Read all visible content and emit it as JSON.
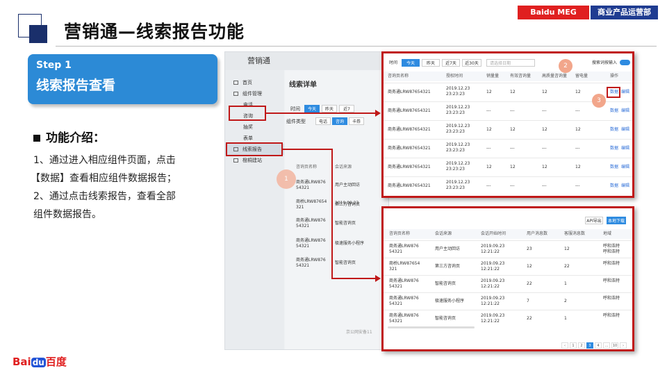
{
  "header": {
    "title": "营销通—线索报告功能",
    "badge_company": "Baidu MEG",
    "badge_dept": "商业产品运营部"
  },
  "step": {
    "label": "Step 1",
    "title": "线索报告查看"
  },
  "intro": {
    "heading": "功能介绍：",
    "line1": "1、通过进入相应组件页面，点击",
    "line2": "【数据】查看相应组件数据报告；",
    "line3": "2、通过点击线索报告，查看全部",
    "line4": "组件数据报告。"
  },
  "logo": {
    "bai": "Bai",
    "du": "du",
    "cn": "百度"
  },
  "app": {
    "title": "营销通",
    "sidebar": {
      "home": "首页",
      "component_mgmt": "组件管理",
      "sub_phone": "电话",
      "sub_consult": "咨询",
      "sub_coupon": "抽奖",
      "sub_form": "表单",
      "lead_report": "线索报告",
      "site_build": "橙桐建站"
    },
    "main": {
      "heading": "线索详单",
      "time_label": "时间",
      "time_today": "今天",
      "time_yesterday": "昨天",
      "time_7": "近7",
      "type_label": "组件类型",
      "type_phone": "电话",
      "type_consult": "咨询",
      "type_more": "卡券",
      "col_page": "咨询页名称",
      "col_source": "会话来源",
      "rows": [
        {
          "name": "商务通LRW876 54321",
          "source": "用户主动回访"
        },
        {
          "name": "商桥LRW87654 321",
          "source": "第三方咨询页"
        },
        {
          "name": "商务通LRW876 54321",
          "source": "智能咨询页"
        },
        {
          "name": "商务通LRW876 54321",
          "source": "极速服务小程序"
        },
        {
          "name": "商务通LRW876 54321",
          "source": "智能咨询页"
        }
      ],
      "peek_date": "2019.09.23",
      "peek_tag": "呼和浩特",
      "footer": "京公网安备11"
    }
  },
  "panel1": {
    "time_label": "时间",
    "tabs": [
      "今天",
      "昨天",
      "近7天",
      "近30天"
    ],
    "date_placeholder": "请选择日期",
    "search_toggle_label": "搜索词按输入",
    "columns": [
      "咨询页名称",
      "授权时间",
      "销量量",
      "有效咨询量",
      "高质量咨询量",
      "留电量",
      "操作"
    ],
    "rows": [
      {
        "name": "商务通LRW87654321",
        "time": "2019.12.23 23:23:23",
        "v1": "12",
        "v2": "12",
        "v3": "12",
        "v4": "12"
      },
      {
        "name": "商务通LRW87654321",
        "time": "2019.12.23 23:23:23",
        "v1": "---",
        "v2": "---",
        "v3": "---",
        "v4": "---"
      },
      {
        "name": "商务通LRW87654321",
        "time": "2019.12.23 23:23:23",
        "v1": "12",
        "v2": "12",
        "v3": "12",
        "v4": "12"
      },
      {
        "name": "商务通LRW87654321",
        "time": "2019.12.23 23:23:23",
        "v1": "---",
        "v2": "---",
        "v3": "---",
        "v4": "---"
      },
      {
        "name": "商务通LRW87654321",
        "time": "2019.12.23 23:23:23",
        "v1": "12",
        "v2": "12",
        "v3": "12",
        "v4": "12"
      },
      {
        "name": "商务通LRW87654321",
        "time": "2019.12.23 23:23:23",
        "v1": "---",
        "v2": "---",
        "v3": "---",
        "v4": "---"
      }
    ],
    "action_data": "数据",
    "action_edit": "编辑"
  },
  "panel2": {
    "api_button": "API导出",
    "export_button": "本地下载",
    "columns": [
      "咨询页名称",
      "会话来源",
      "会话开始时间",
      "用户消息数",
      "客服消息数",
      "地域"
    ],
    "rows": [
      {
        "name": "商务通LRW876 54321",
        "source": "用户主动回访",
        "time": "2019.09.23 12:21:22",
        "u": "23",
        "c": "12",
        "region": "呼和浩特 呼和浩特"
      },
      {
        "name": "商桥LRW87654 321",
        "source": "第三方咨询页",
        "time": "2019.09.23 12:21:22",
        "u": "12",
        "c": "22",
        "region": "呼和浩特"
      },
      {
        "name": "商务通LRW876 54321",
        "source": "智能咨询页",
        "time": "2019.09.23 12:21:22",
        "u": "22",
        "c": "1",
        "region": "呼和浩特"
      },
      {
        "name": "商务通LRW876 54321",
        "source": "极速服务小程序",
        "time": "2019.09.23 12:21:22",
        "u": "7",
        "c": "2",
        "region": "呼和浩特"
      },
      {
        "name": "商务通LRW876 54321",
        "source": "智能咨询页",
        "time": "2019.09.23 12:21:22",
        "u": "22",
        "c": "1",
        "region": "呼和浩特"
      }
    ],
    "pages": [
      "‹",
      "1",
      "2",
      "3",
      "4",
      "...",
      "10",
      "›"
    ]
  },
  "markers": {
    "m1": "1",
    "m2": "2",
    "m3": "3"
  },
  "colors": {
    "accent_red": "#c01818",
    "brand_blue": "#1f3c91",
    "step_blue": "#2c8ad6",
    "ui_blue": "#2e8be0"
  }
}
